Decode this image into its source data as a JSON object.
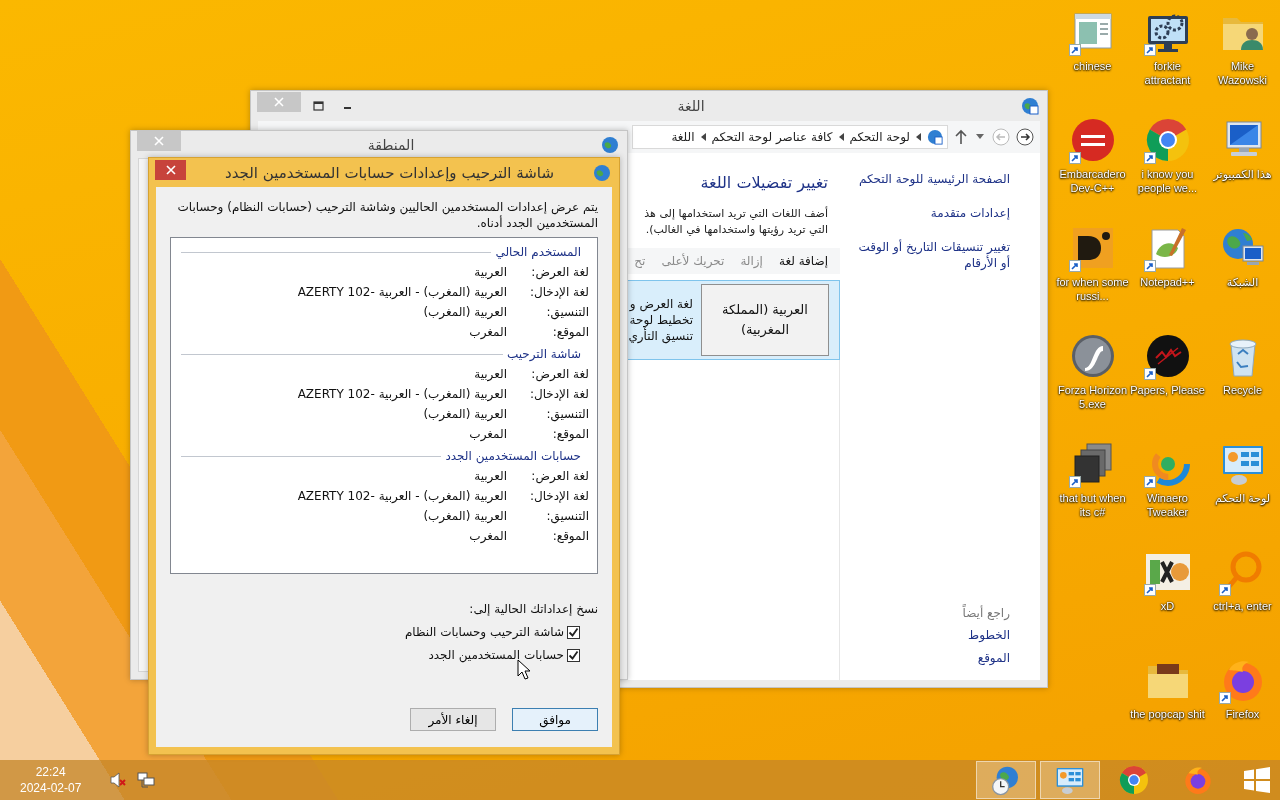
{
  "desktop": {
    "icon_columns": [
      [
        {
          "label": "Mike Wazowski",
          "shortcut": false
        },
        {
          "label": "هذا الكمبيوتر",
          "shortcut": false
        },
        {
          "label": "الشبكة",
          "shortcut": false
        },
        {
          "label": "Recycle",
          "shortcut": false
        },
        {
          "label": "لوحة التحكم",
          "shortcut": false
        },
        {
          "label": "ctrl+a, enter",
          "shortcut": true
        },
        {
          "label": "Firefox",
          "shortcut": true
        }
      ],
      [
        {
          "label": "forkie attractant",
          "shortcut": true
        },
        {
          "label": "i know you people we...",
          "shortcut": true
        },
        {
          "label": "Notepad++",
          "shortcut": true
        },
        {
          "label": "Papers, Please",
          "shortcut": true
        },
        {
          "label": "Winaero Tweaker",
          "shortcut": true
        },
        {
          "label": "xD",
          "shortcut": true
        },
        {
          "label": "the popcap shit",
          "shortcut": false
        }
      ],
      [
        {
          "label": "chinese",
          "shortcut": true
        },
        {
          "label": "Embarcadero Dev-C++",
          "shortcut": true
        },
        {
          "label": "for when some russi...",
          "shortcut": true
        },
        {
          "label": "Forza Horizon 5.exe",
          "shortcut": false
        },
        {
          "label": "that but when its c#",
          "shortcut": true
        }
      ]
    ]
  },
  "language_window": {
    "title": "اللغة",
    "breadcrumb": [
      "لوحة التحكم",
      "كافة عناصر لوحة التحكم",
      "اللغة"
    ],
    "sidebar": {
      "links": [
        "الصفحة الرئيسية للوحة التحكم",
        "إعدادات متقدمة",
        "تغيير تنسيقات التاريخ أو الوقت أو الأرقام"
      ],
      "see_also_title": "راجع أيضاً",
      "see_also": [
        "الخطوط",
        "الموقع"
      ]
    },
    "heading": "تغيير تفضيلات اللغة",
    "description_lines": [
      "أضف اللغات التي تريد استخدامها إلى هذ",
      "التي تريد رؤيتها واستخدامها في الغالب)."
    ],
    "toolbar": [
      {
        "label": "إضافة لغة",
        "disabled": false
      },
      {
        "label": "إزالة",
        "disabled": true
      },
      {
        "label": "تحريك لأعلى",
        "disabled": true
      },
      {
        "label": "تح",
        "disabled": true
      }
    ],
    "language": {
      "name": "العربية (المملكة المغربية)",
      "details": [
        "لغة العرض ﻭ",
        "تخطيط لوحة",
        "تنسيق التأري"
      ]
    }
  },
  "region_window": {
    "title": "المنطقة"
  },
  "dialog": {
    "title": "شاشة الترحيب وإعدادات حسابات المستخدمين الجدد",
    "description": "يتم عرض إعدادات المستخدمين الحاليين وشاشة الترحيب (حسابات النظام) وحسابات المستخدمين الجدد أدناه.",
    "sections": [
      {
        "title": "المستخدم الحالي",
        "rows": [
          {
            "label": "لغة العرض:",
            "value": "العربية"
          },
          {
            "label": "لغة الإدخال:",
            "value": "العربية (المغرب) - العربية -AZERTY 102"
          },
          {
            "label": "التنسيق:",
            "value": "العربية (المغرب)"
          },
          {
            "label": "الموقع:",
            "value": "المغرب"
          }
        ]
      },
      {
        "title": "شاشة الترحيب",
        "rows": [
          {
            "label": "لغة العرض:",
            "value": "العربية"
          },
          {
            "label": "لغة الإدخال:",
            "value": "العربية (المغرب) - العربية -AZERTY 102"
          },
          {
            "label": "التنسيق:",
            "value": "العربية (المغرب)"
          },
          {
            "label": "الموقع:",
            "value": "المغرب"
          }
        ]
      },
      {
        "title": "حسابات المستخدمين الجدد",
        "rows": [
          {
            "label": "لغة العرض:",
            "value": "العربية"
          },
          {
            "label": "لغة الإدخال:",
            "value": "العربية (المغرب) - العربية -AZERTY 102"
          },
          {
            "label": "التنسيق:",
            "value": "العربية (المغرب)"
          },
          {
            "label": "الموقع:",
            "value": "المغرب"
          }
        ]
      }
    ],
    "copy_label": "نسخ إعداداتك الحالية إلى:",
    "checkboxes": [
      {
        "label": "شاشة الترحيب وحسابات النظام",
        "checked": true
      },
      {
        "label": "حسابات المستخدمين الجدد",
        "checked": true
      }
    ],
    "buttons": [
      {
        "label": "موافق",
        "default": true
      },
      {
        "label": "إلغاء الأمر",
        "default": false
      }
    ]
  },
  "taskbar": {
    "clock": {
      "time": "22:24",
      "date": "2024-02-07"
    },
    "tray": [
      {
        "kind": "volume",
        "muted": true
      },
      {
        "kind": "network"
      }
    ],
    "pinned": [
      {
        "active": true
      },
      {
        "active": true
      },
      {
        "active": false
      },
      {
        "active": false
      }
    ]
  }
}
